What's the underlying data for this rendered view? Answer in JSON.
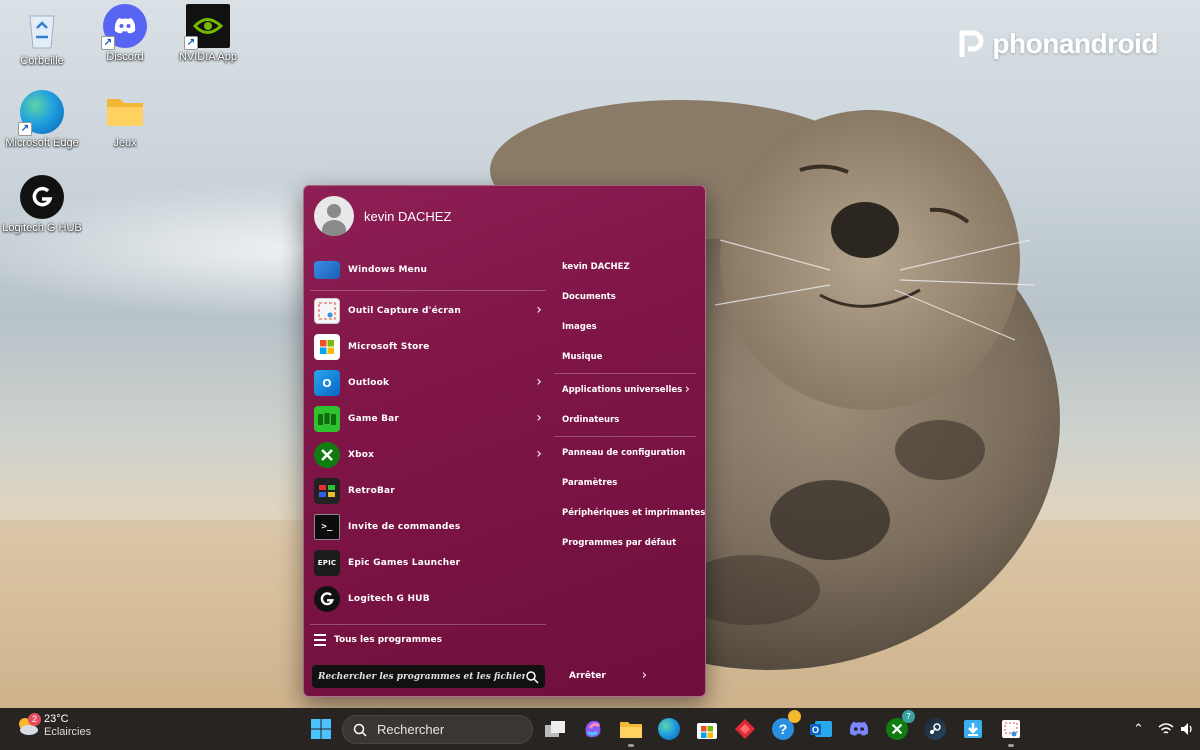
{
  "desktop": {
    "icons": [
      {
        "label": "Corbeille",
        "icon": "recycle-bin-icon"
      },
      {
        "label": "Discord",
        "icon": "discord-icon"
      },
      {
        "label": "NVIDIA App",
        "icon": "nvidia-icon"
      },
      {
        "label": "Microsoft Edge",
        "icon": "edge-icon"
      },
      {
        "label": "Jeux",
        "icon": "folder-icon"
      },
      {
        "label": "Logitech G HUB",
        "icon": "logitech-g-icon"
      }
    ],
    "watermark": "phonandroid"
  },
  "start_menu": {
    "user_name": "kevin DACHEZ",
    "programs": [
      {
        "label": "Windows Menu",
        "icon": "windows-menu-icon",
        "submenu": false
      },
      {
        "label": "Outil Capture d'écran",
        "icon": "snipping-tool-icon",
        "submenu": true
      },
      {
        "label": "Microsoft Store",
        "icon": "store-icon",
        "submenu": false
      },
      {
        "label": "Outlook",
        "icon": "outlook-icon",
        "submenu": true
      },
      {
        "label": "Game Bar",
        "icon": "game-bar-icon",
        "submenu": true
      },
      {
        "label": "Xbox",
        "icon": "xbox-icon",
        "submenu": true
      },
      {
        "label": "RetroBar",
        "icon": "retrobar-icon",
        "submenu": false
      },
      {
        "label": "Invite de commandes",
        "icon": "cmd-icon",
        "submenu": false
      },
      {
        "label": "Epic Games Launcher",
        "icon": "epic-games-icon",
        "submenu": false
      },
      {
        "label": "Logitech G HUB",
        "icon": "logitech-g-icon",
        "submenu": false
      }
    ],
    "all_programs": "Tous les programmes",
    "search_placeholder": "Rechercher les programmes et les fichiers",
    "places": [
      {
        "label": "kevin DACHEZ"
      },
      {
        "label": "Documents"
      },
      {
        "label": "Images"
      },
      {
        "label": "Musique"
      },
      {
        "label": "Applications universelles",
        "submenu": true
      },
      {
        "label": "Ordinateurs"
      },
      {
        "label": "Panneau de configuration"
      },
      {
        "label": "Paramètres"
      },
      {
        "label": "Périphériques et imprimantes"
      },
      {
        "label": "Programmes par défaut"
      }
    ],
    "shutdown": "Arrêter",
    "accent": "#7e1546"
  },
  "taskbar": {
    "weather": {
      "temp": "23°C",
      "desc": "Eclaircies",
      "badge": "2"
    },
    "search_label": "Rechercher",
    "apps": [
      "task-view-icon",
      "copilot-icon",
      "file-explorer-icon",
      "edge-icon",
      "store-icon",
      "retro-diamond-icon",
      "help-icon",
      "outlook-icon",
      "discord-icon",
      "xbox-icon",
      "steam-icon",
      "app-installer-icon",
      "snipping-tool-icon"
    ],
    "xbox_badge": "7",
    "background": "#282422"
  }
}
